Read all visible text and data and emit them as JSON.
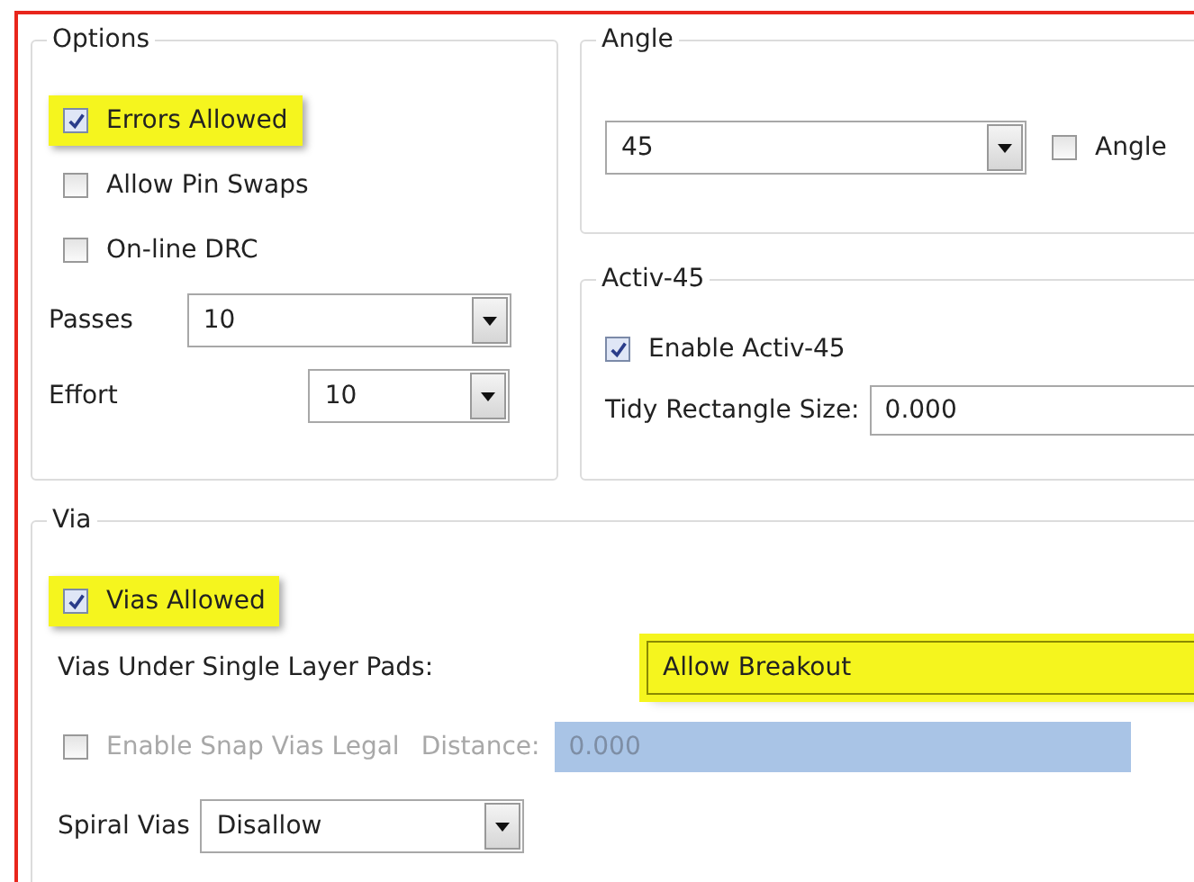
{
  "options": {
    "title": "Options",
    "checkboxes": [
      {
        "label": "Errors Allowed",
        "checked": true,
        "highlighted": true
      },
      {
        "label": "Allow Pin Swaps",
        "checked": false,
        "highlighted": false
      },
      {
        "label": "On-line DRC",
        "checked": false,
        "highlighted": false
      }
    ],
    "passes": {
      "label": "Passes",
      "value": "10"
    },
    "effort": {
      "label": "Effort",
      "value": "10"
    }
  },
  "angle": {
    "title": "Angle",
    "value": "45",
    "checkbox": {
      "label": "Angle",
      "checked": false
    }
  },
  "activ45": {
    "title": "Activ-45",
    "checkbox": {
      "label": "Enable Activ-45",
      "checked": true
    },
    "tidy": {
      "label": "Tidy Rectangle Size:",
      "value": "0.000"
    }
  },
  "via": {
    "title": "Via",
    "vias_allowed": {
      "label": "Vias Allowed",
      "checked": true,
      "highlighted": true
    },
    "pads": {
      "label": "Vias Under Single Layer Pads:",
      "value": "Allow Breakout",
      "highlighted": true
    },
    "snap": {
      "label": "Enable Snap Vias Legal",
      "checked": false,
      "disabled": true
    },
    "distance": {
      "label": "Distance:",
      "value": "0.000",
      "disabled": true
    },
    "spiral": {
      "label": "Spiral Vias",
      "value": "Disallow"
    }
  }
}
